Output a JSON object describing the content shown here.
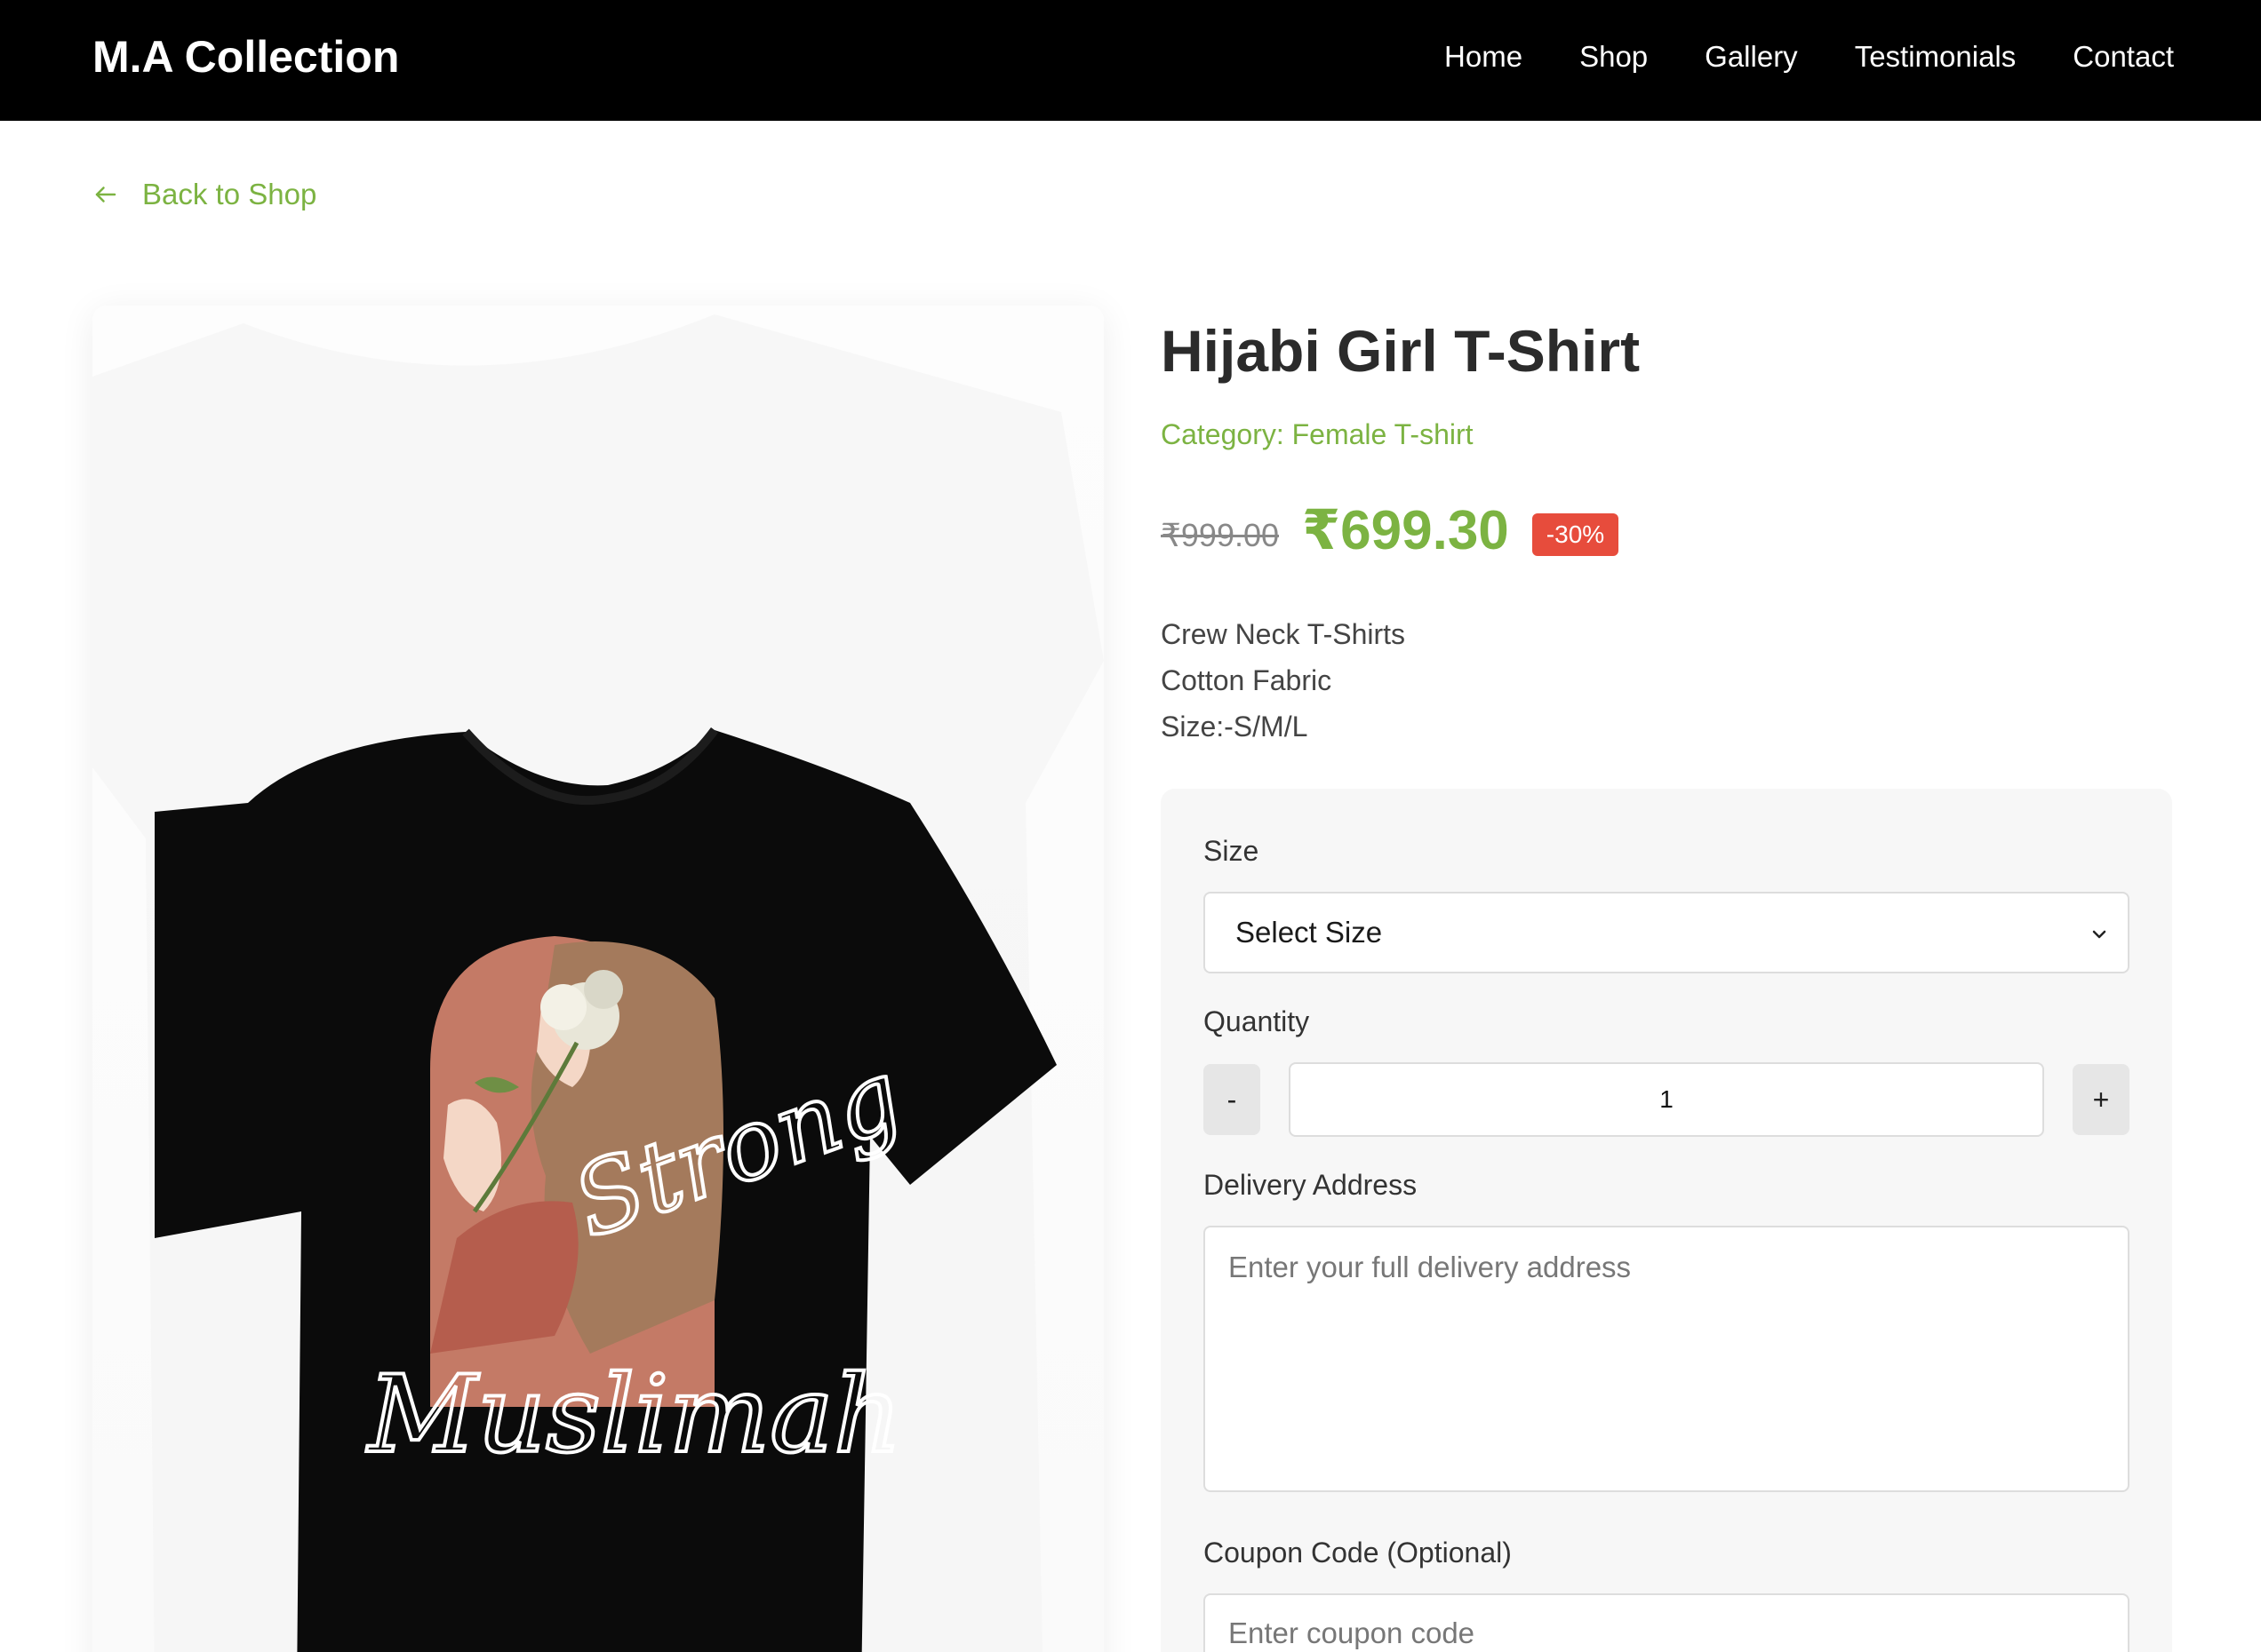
{
  "header": {
    "brand": "M.A Collection",
    "nav": [
      "Home",
      "Shop",
      "Gallery",
      "Testimonials",
      "Contact"
    ]
  },
  "back_link": {
    "label": "Back to Shop",
    "icon": "arrow-left-icon"
  },
  "product": {
    "title": "Hijabi Girl T-Shirt",
    "category": "Category: Female T-shirt",
    "old_price": "₹999.00",
    "price": "₹699.30",
    "discount": "-30%",
    "description": [
      "Crew Neck T-Shirts",
      "Cotton Fabric",
      "Size:-S/M/L"
    ],
    "image_text": [
      "Strong",
      "Muslimah"
    ]
  },
  "form": {
    "size_label": "Size",
    "size_selected": "Select Size",
    "quantity_label": "Quantity",
    "quantity_value": "1",
    "minus_label": "-",
    "plus_label": "+",
    "address_label": "Delivery Address",
    "address_placeholder": "Enter your full delivery address",
    "coupon_label": "Coupon Code (Optional)",
    "coupon_placeholder": "Enter coupon code"
  },
  "colors": {
    "accent": "#7cb342",
    "badge": "#e74c3c",
    "header_bg": "#000000"
  }
}
